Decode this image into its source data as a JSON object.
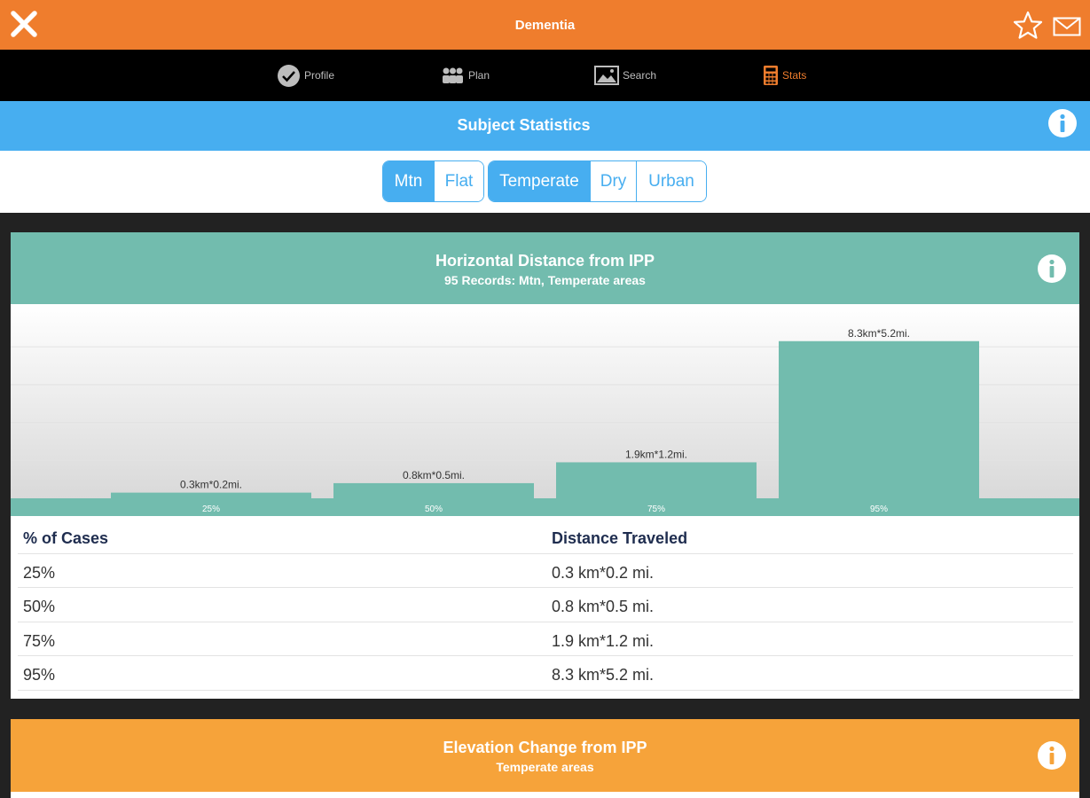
{
  "header": {
    "title": "Dementia",
    "icons": [
      "close-icon",
      "star-icon",
      "mail-icon"
    ],
    "color": "#ef7d2d"
  },
  "tabs": [
    {
      "label": "Profile",
      "icon": "check-circle-icon"
    },
    {
      "label": "Plan",
      "icon": "people-icon"
    },
    {
      "label": "Search",
      "icon": "image-icon"
    },
    {
      "label": "Stats",
      "icon": "calculator-icon",
      "active": true
    }
  ],
  "subject": {
    "title": "Subject Statistics",
    "color": "#47aef0"
  },
  "filters": {
    "terrain": [
      {
        "label": "Mtn",
        "selected": true
      },
      {
        "label": "Flat",
        "selected": false
      }
    ],
    "climate": [
      {
        "label": "Temperate",
        "selected": true
      },
      {
        "label": "Dry",
        "selected": false
      },
      {
        "label": "Urban",
        "selected": false
      }
    ]
  },
  "horizontal": {
    "title": "Horizontal Distance from IPP",
    "subtitle": "95 Records: Mtn, Temperate areas",
    "color": "#72bcae",
    "table": {
      "headers": [
        "% of Cases",
        "Distance Traveled"
      ],
      "rows": [
        [
          "25%",
          "0.3 km*0.2 mi."
        ],
        [
          "50%",
          "0.8 km*0.5 mi."
        ],
        [
          "75%",
          "1.9 km*1.2 mi."
        ],
        [
          "95%",
          "8.3 km*5.2 mi."
        ]
      ]
    }
  },
  "chart_data": {
    "type": "bar",
    "categories": [
      "25%",
      "50%",
      "75%",
      "95%"
    ],
    "values": [
      0.3,
      0.8,
      1.9,
      8.3
    ],
    "data_labels": [
      "0.3km*0.2mi.",
      "0.8km*0.5mi.",
      "1.9km*1.2mi.",
      "8.3km*5.2mi."
    ],
    "ylim": [
      0,
      9.6
    ],
    "grid": true,
    "bar_color": "#72bcae"
  },
  "elevation": {
    "title": "Elevation Change from IPP",
    "subtitle": "Temperate areas",
    "color": "#f6a33a"
  }
}
